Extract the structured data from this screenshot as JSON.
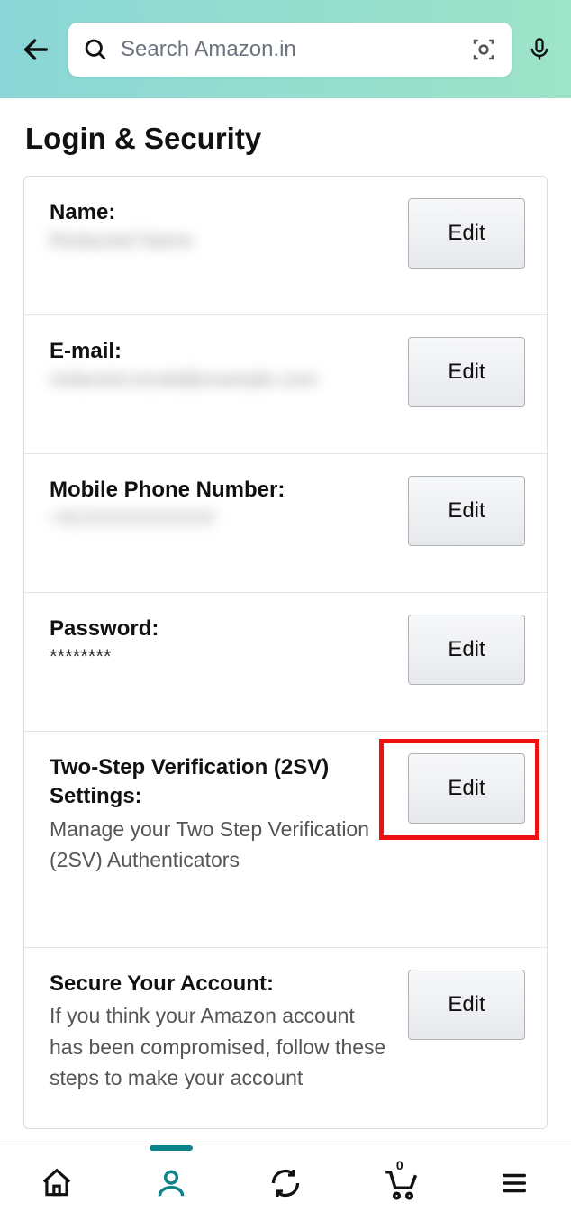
{
  "header": {
    "search_placeholder": "Search Amazon.in"
  },
  "page": {
    "title": "Login & Security"
  },
  "settings": [
    {
      "label": "Name:",
      "value": "Redacted Name",
      "desc": "",
      "edit": "Edit",
      "blurred": true
    },
    {
      "label": "E-mail:",
      "value": "redacted.email@example.com",
      "desc": "",
      "edit": "Edit",
      "blurred": true
    },
    {
      "label": "Mobile Phone Number:",
      "value": "+91XXXXXXXXXX",
      "desc": "",
      "edit": "Edit",
      "blurred": true
    },
    {
      "label": "Password:",
      "value": "********",
      "desc": "",
      "edit": "Edit",
      "blurred": false
    },
    {
      "label": "Two-Step Verification (2SV) Settings:",
      "value": "",
      "desc": "Manage your Two Step Verification (2SV) Authenticators",
      "edit": "Edit",
      "blurred": false,
      "highlight": true
    },
    {
      "label": "Secure Your Account:",
      "value": "",
      "desc": "If you think your Amazon account has been compromised, follow these steps to make your account",
      "edit": "Edit",
      "blurred": false
    }
  ],
  "nav": {
    "cart_count": "0"
  }
}
